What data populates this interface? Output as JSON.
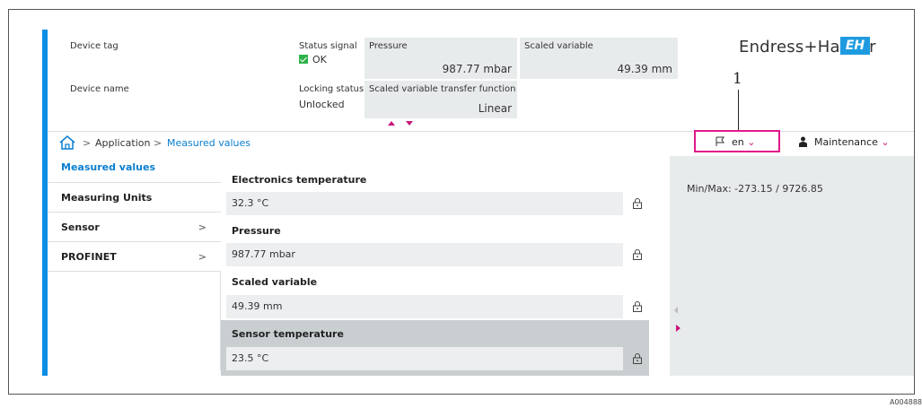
{
  "header": {
    "device_tag_label": "Device tag",
    "device_name_label": "Device name",
    "status_signal_label": "Status signal",
    "status_signal_value": "OK",
    "locking_status_label": "Locking status",
    "locking_status_value": "Unlocked",
    "pressure_label": "Pressure",
    "pressure_value": "987.77 mbar",
    "scaled_variable_label": "Scaled variable",
    "scaled_variable_value": "49.39 mm",
    "transfer_function_label": "Scaled variable transfer function",
    "transfer_function_value": "Linear"
  },
  "brand": {
    "name": "Endress+Hauser",
    "logo_mark": "EH"
  },
  "callout": "1",
  "breadcrumb": {
    "items": [
      "Application",
      "Measured values"
    ],
    "separator": ">"
  },
  "language": {
    "value": "en",
    "icon": "flag-icon"
  },
  "user": {
    "role": "Maintenance",
    "icon": "person-icon"
  },
  "sidebar": {
    "items": [
      {
        "label": "Measured values",
        "has_children": false
      },
      {
        "label": "Measuring Units",
        "has_children": false
      },
      {
        "label": "Sensor",
        "has_children": true
      },
      {
        "label": "PROFINET",
        "has_children": true
      }
    ],
    "chevron": ">"
  },
  "fields": [
    {
      "label": "Electronics temperature",
      "value": "32.3 °C"
    },
    {
      "label": "Pressure",
      "value": "987.77 mbar"
    },
    {
      "label": "Scaled variable",
      "value": "49.39 mm"
    },
    {
      "label": "Sensor temperature",
      "value": "23.5 °C"
    }
  ],
  "info_panel": {
    "minmax": "Min/Max: -273.15 / 9726.85"
  },
  "figure_code": "A004888",
  "colors": {
    "accent_blue": "#0a8ee6",
    "highlight_magenta": "#e0188a",
    "status_ok": "#2db24a"
  }
}
